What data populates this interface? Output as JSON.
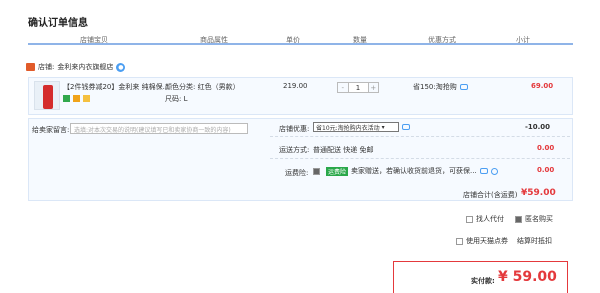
{
  "page": {
    "title": "确认订单信息"
  },
  "table_header": {
    "col1": "店铺宝贝",
    "col2": "商品属性",
    "col3": "单价",
    "col4": "数量",
    "col5": "优惠方式",
    "col6": "小计"
  },
  "shop": {
    "label": "店铺:",
    "name": "金利来内衣旗舰店"
  },
  "item": {
    "title": "【2件钱券减20】金利来 纯棉保...",
    "attr_color": "颜色分类: 红色（男款）",
    "attr_size": "尺码: L",
    "price": "219.00",
    "qty": "1",
    "qty_minus": "-",
    "qty_plus": "+",
    "discount": "省150:淘抢购",
    "subtotal": "69.00"
  },
  "remark": {
    "label": "给卖家留言:",
    "placeholder": "选填:对本次交易的说明(建议填写已和卖家协商一致的内容)"
  },
  "coupon": {
    "label": "店铺优惠:",
    "value": "省10元:淘抢购内衣活动",
    "amount": "-10.00"
  },
  "shipping": {
    "label": "运送方式:",
    "value": "普通配送 快递 免邮",
    "amount": "0.00"
  },
  "insurance": {
    "label": "运费险:",
    "badge": "运费险",
    "desc": "卖家赠送，若确认收货前退货，可获保...",
    "amount": "0.00"
  },
  "shop_total": {
    "label": "店铺合计(含运费)",
    "amount": "¥59.00"
  },
  "options": {
    "anon": "匿名购买",
    "proxy": "找人代付",
    "tmall_points": "使用天猫点券",
    "checkout_note": "结算时抵扣"
  },
  "actual_pay": {
    "label": "实付款:",
    "amount": "¥ 59.00"
  },
  "colors": {
    "accent": "#e4393c",
    "header_line": "#8fb4e8",
    "row_bg": "#f6faff"
  }
}
